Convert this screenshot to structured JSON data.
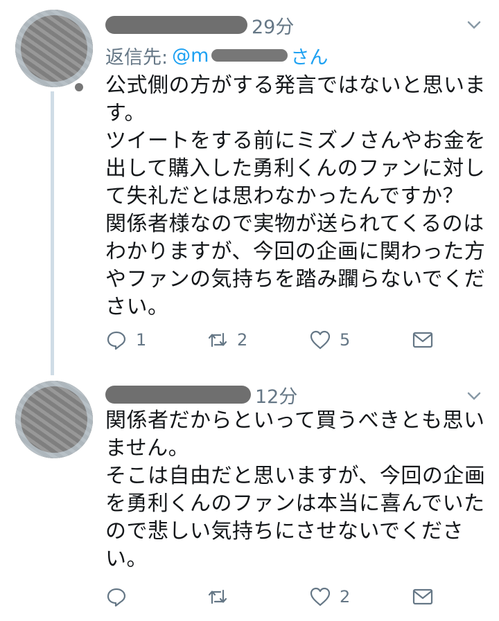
{
  "tweets": [
    {
      "time": "29分",
      "reply_label": "返信先:",
      "reply_handle": "@m",
      "reply_suffix": "さん",
      "body": "公式側の方がする発言ではないと思います。\nツイートをする前にミズノさんやお金を出して購入した勇利くんのファンに対して失礼だとは思わなかったんですか？\n関係者様なので実物が送られてくるのはわかりますが、今回の企画に関わった方やファンの気持ちを踏み躙らないでください。",
      "actions": {
        "reply_count": "1",
        "retweet_count": "2",
        "like_count": "5"
      }
    },
    {
      "time": "12分",
      "body": "関係者だからといって買うべきとも思いません。\nそこは自由だと思いますが、今回の企画を勇利くんのファンは本当に喜んでいたので悲しい気持ちにさせないでください。",
      "actions": {
        "reply_count": "",
        "retweet_count": "",
        "like_count": "2"
      }
    }
  ],
  "colors": {
    "meta": "#657786",
    "link": "#1da1f2",
    "thread": "#cfdce6",
    "text": "#14171a"
  },
  "icons": [
    "reply-icon",
    "retweet-icon",
    "like-icon",
    "direct-message-icon",
    "chevron-down-icon"
  ]
}
